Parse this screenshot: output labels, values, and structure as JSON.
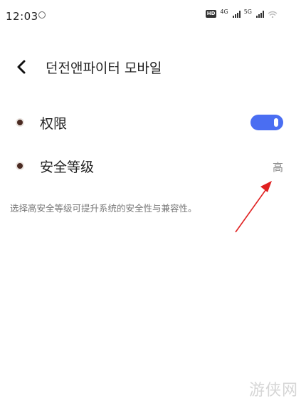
{
  "status_bar": {
    "time": "12:03",
    "hd_badge": "HD",
    "network_1": "4G",
    "network_2": "5G"
  },
  "nav": {
    "title": "던전앤파이터 모바일"
  },
  "settings": {
    "permissions_label": "权限",
    "permissions_enabled": true,
    "security_label": "安全等级",
    "security_value": "高"
  },
  "description": "选择高安全等级可提升系统的安全性与兼容性。",
  "watermark": "游侠网",
  "colors": {
    "toggle_on": "#4a6ef2",
    "annotation_arrow": "#e02020"
  }
}
